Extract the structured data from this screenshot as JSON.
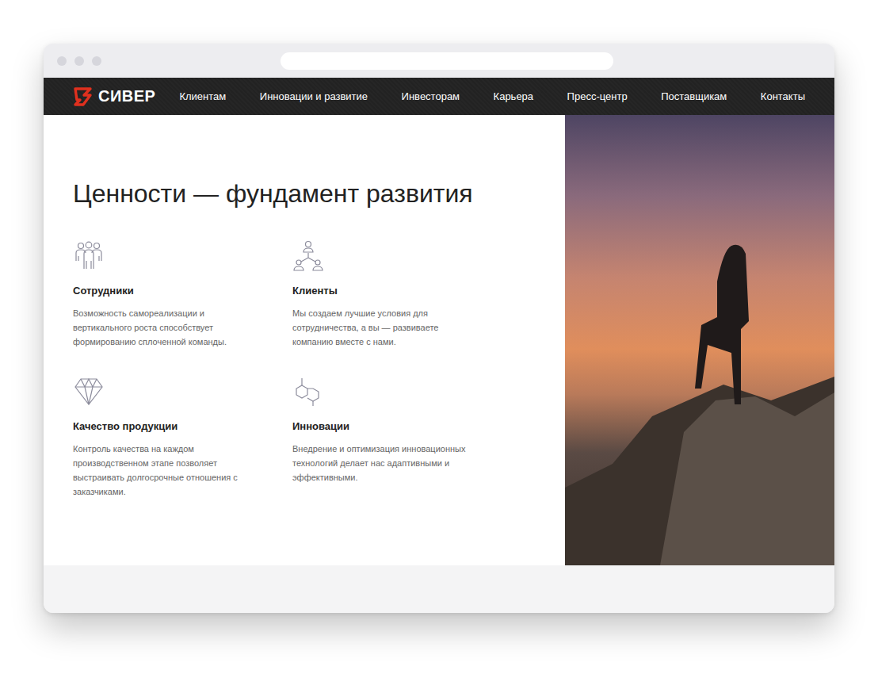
{
  "site": {
    "logo": "СИВЕР",
    "nav": [
      "Клиентам",
      "Инновации и развитие",
      "Инвесторам",
      "Карьера",
      "Пресс-центр",
      "Поставщикам",
      "Контакты"
    ]
  },
  "values": {
    "title": "Ценности — фундамент развития",
    "items": [
      {
        "title": "Сотрудники",
        "text": "Возможность самореализации и вертикального роста способствует формированию сплоченной команды."
      },
      {
        "title": "Клиенты",
        "text": "Мы создаем лучшие условия для сотрудничества, а вы — развиваете компанию вместе с нами."
      },
      {
        "title": "Качество продукции",
        "text": "Контроль качества на каждом производственном этапе позволяет выстраивать долгосрочные отношения с заказчиками."
      },
      {
        "title": "Инновации",
        "text": "Внедрение и оптимизация инновационных технологий делает нас адаптивными и эффективными."
      }
    ]
  }
}
